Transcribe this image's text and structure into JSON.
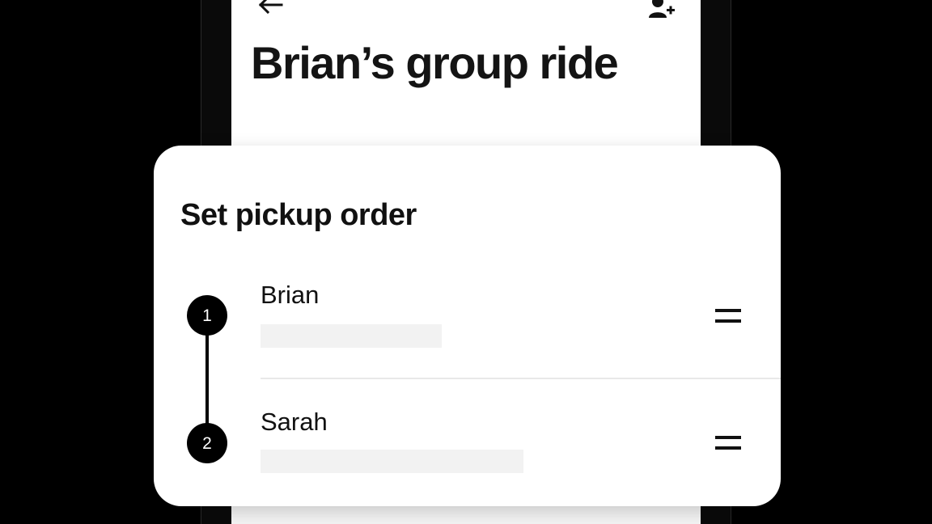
{
  "screen": {
    "title": "Brian’s group ride",
    "back_icon": "arrow-left-icon",
    "add_icon": "add-person-icon"
  },
  "sheet": {
    "title": "Set pickup order",
    "riders": [
      {
        "order": "1",
        "name": "Brian"
      },
      {
        "order": "2",
        "name": "Sarah"
      }
    ],
    "handle_icon": "drag-handle-icon"
  },
  "colors": {
    "background": "#000000",
    "surface": "#ffffff",
    "text": "#111111",
    "badge": "#000000",
    "placeholder": "#f2f2f2"
  }
}
